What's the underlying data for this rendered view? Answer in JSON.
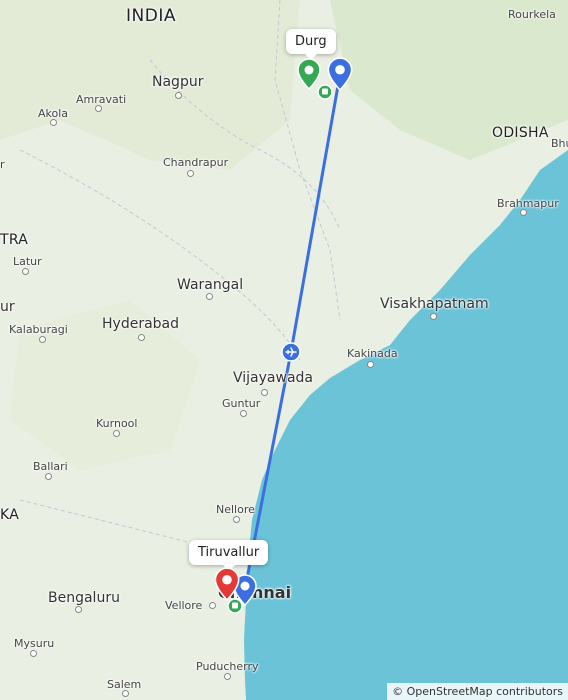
{
  "map": {
    "labels": {
      "india": "INDIA",
      "odisha": "ODISHA",
      "rourkela": "Rourkela",
      "nagpur": "Nagpur",
      "amravati": "Amravati",
      "akola": "Akola",
      "chandrapur": "Chandrapur",
      "brahmapur": "Brahmapur",
      "bhu": "Bhu",
      "tra": "TRA",
      "latur": "Latur",
      "warangal": "Warangal",
      "hyderabad": "Hyderabad",
      "kalaburagi": "Kalaburagi",
      "visakhapatnam": "Visakhapatnam",
      "kakinada": "Kakinada",
      "vijayawada": "Vijayawada",
      "guntur": "Guntur",
      "kurnool": "Kurnool",
      "ballari": "Ballari",
      "ka": "KA",
      "nellore": "Nellore",
      "bengaluru": "Bengaluru",
      "vellore": "Vellore",
      "chennai": "Chennai",
      "mysuru": "Mysuru",
      "puducherry": "Puducherry",
      "salem": "Salem",
      "r": "r",
      "ur": "ur"
    },
    "callouts": {
      "durg": "Durg",
      "tiruvallur": "Tiruvallur"
    },
    "colors": {
      "land": "#e9efe2",
      "sea": "#6bc3d7",
      "route": "#3b6fe0",
      "pin_green": "#34a853",
      "pin_blue": "#3b6fe0",
      "pin_red": "#e53935"
    },
    "attribution": "© OpenStreetMap contributors"
  }
}
